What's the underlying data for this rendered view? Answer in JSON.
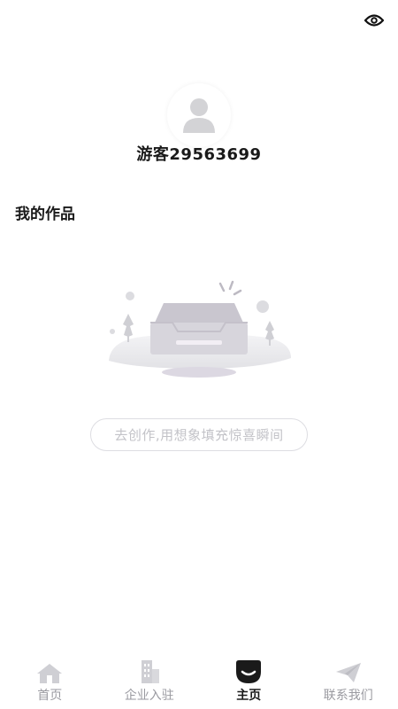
{
  "header": {
    "eye_icon": "eye-icon"
  },
  "profile": {
    "avatar_icon": "user-avatar-icon",
    "username": "游客29563699"
  },
  "works": {
    "title": "我的作品",
    "empty_illustration": "empty-inbox-icon",
    "create_prompt": "去创作,用想象填充惊喜瞬间"
  },
  "tabbar": {
    "items": [
      {
        "label": "首页",
        "icon": "home-icon",
        "active": false
      },
      {
        "label": "企业入驻",
        "icon": "building-icon",
        "active": false
      },
      {
        "label": "主页",
        "icon": "profile-home-icon",
        "active": true
      },
      {
        "label": "联系我们",
        "icon": "paper-plane-icon",
        "active": false
      }
    ]
  },
  "colors": {
    "accent": "#1a1a1a",
    "inactive": "#9a9aa0",
    "placeholder": "#c3c3c8"
  }
}
